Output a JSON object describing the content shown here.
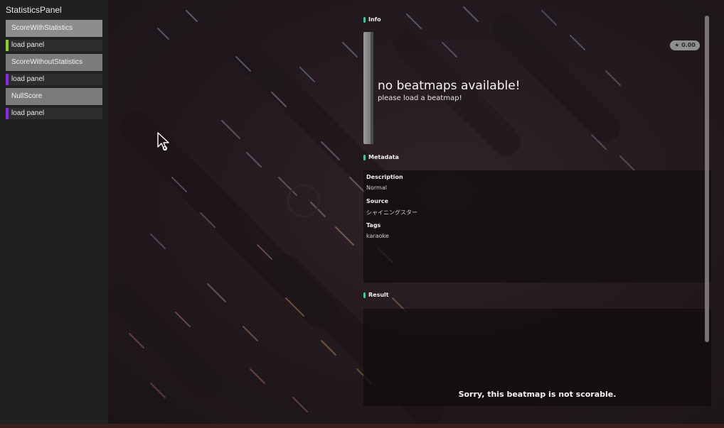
{
  "sidebar": {
    "title": "StatisticsPanel",
    "steps": [
      {
        "label": "ScoreWithStatistics",
        "active": true
      },
      {
        "label": "load panel",
        "kind": "action",
        "bar_color": "#8ad22a"
      },
      {
        "label": "ScoreWithoutStatistics",
        "active": false
      },
      {
        "label": "load panel",
        "kind": "action",
        "bar_color": "#8a2be2"
      },
      {
        "label": "NullScore",
        "active": false
      },
      {
        "label": "load panel",
        "kind": "action",
        "bar_color": "#8a2be2"
      }
    ]
  },
  "panel": {
    "info_header": "Info",
    "info": {
      "title": "no beatmaps available!",
      "subtitle": "please load a beatmap!",
      "star_rating": "★ 0.00"
    },
    "metadata_header": "Metadata",
    "metadata": {
      "description_label": "Description",
      "description_value": "Normal",
      "source_label": "Source",
      "source_value": "シャイニングスター",
      "tags_label": "Tags",
      "tags_value": "karaoke"
    },
    "result_header": "Result",
    "result_message": "Sorry, this beatmap is not scorable."
  },
  "colors": {
    "accent_green": "#2bd49f",
    "sidebar_bg": "#202020",
    "scene_bg": "#281d22"
  },
  "icons": {
    "cursor": "mouse-cursor-icon"
  }
}
